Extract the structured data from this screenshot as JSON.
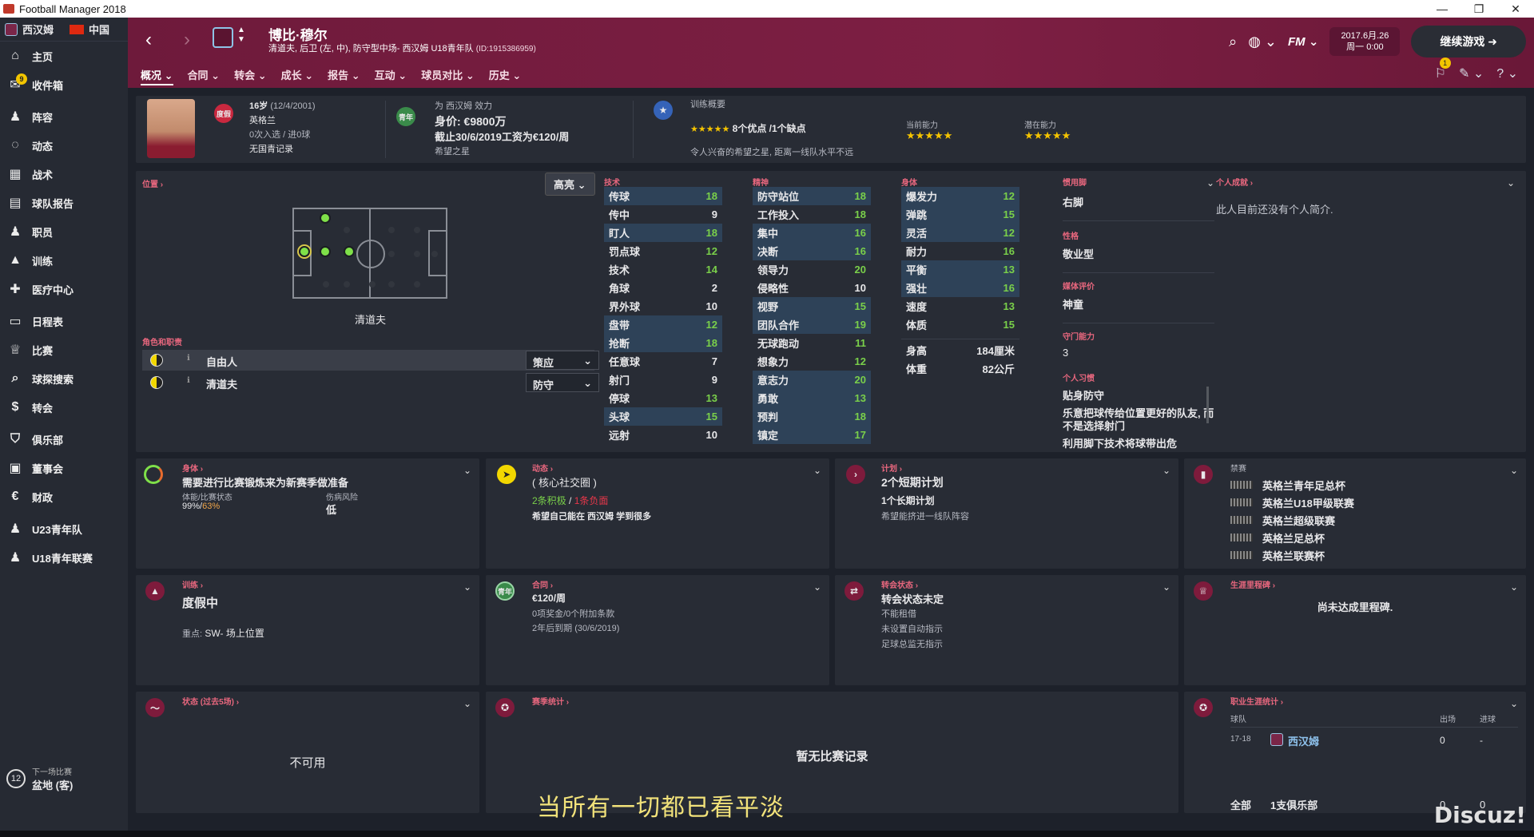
{
  "window": {
    "title": "Football Manager 2018",
    "controls": [
      "—",
      "❐",
      "✕"
    ]
  },
  "sidebar": {
    "club": "西汉姆",
    "nation": "中国",
    "items": [
      {
        "label": "主页",
        "icon": "home-icon",
        "glyph": "⌂"
      },
      {
        "label": "收件箱",
        "icon": "inbox-icon",
        "glyph": "✉",
        "badge": "9"
      },
      {
        "label": "阵容",
        "icon": "squad-icon",
        "glyph": "♟"
      },
      {
        "label": "动态",
        "icon": "dynamics-icon",
        "glyph": "◌"
      },
      {
        "label": "战术",
        "icon": "tactics-icon",
        "glyph": "▦"
      },
      {
        "label": "球队报告",
        "icon": "report-icon",
        "glyph": "▤"
      },
      {
        "label": "职员",
        "icon": "staff-icon",
        "glyph": "♟"
      },
      {
        "label": "训练",
        "icon": "training-icon",
        "glyph": "▲"
      },
      {
        "label": "医疗中心",
        "icon": "medical-icon",
        "glyph": "✚"
      },
      {
        "label": "日程表",
        "icon": "calendar-icon",
        "glyph": "▭"
      },
      {
        "label": "比赛",
        "icon": "trophy-icon",
        "glyph": "♕"
      },
      {
        "label": "球探搜索",
        "icon": "scout-search-icon",
        "glyph": "⌕"
      },
      {
        "label": "转会",
        "icon": "transfer-icon",
        "glyph": "$"
      },
      {
        "label": "俱乐部",
        "icon": "club-icon",
        "glyph": "⛉"
      },
      {
        "label": "董事会",
        "icon": "board-icon",
        "glyph": "▣"
      },
      {
        "label": "财政",
        "icon": "finance-icon",
        "glyph": "€"
      },
      {
        "label": "U23青年队",
        "icon": "u23-icon",
        "glyph": "♟"
      },
      {
        "label": "U18青年联赛",
        "icon": "u18-icon",
        "glyph": "♟"
      }
    ],
    "next_match": {
      "caption": "下一场比赛",
      "opponent": "盆地 (客)",
      "day": "12"
    }
  },
  "header": {
    "player_name": "博比·穆尔",
    "player_sub": "清道夫, 后卫 (左, 中), 防守型中场- 西汉姆 U18青年队",
    "player_id": "(ID:1915386959)",
    "tabs": [
      "概况",
      "合同",
      "转会",
      "成长",
      "报告",
      "互动",
      "球员对比",
      "历史"
    ],
    "date": "2017.6月.26",
    "time": "周一 0:00",
    "continue": "继续游戏",
    "fm_label": "FM",
    "notif_count": "1"
  },
  "summary": {
    "status_badge": "度假",
    "age": "16岁",
    "dob": "(12/4/2001)",
    "nation": "英格兰",
    "caps": "0次入选 / 进0球",
    "youth_record": "无国青记录",
    "youth_badge": "青年",
    "plays_for": "为 西汉姆 效力",
    "value": "身价: €9800万",
    "contract": "截止30/6/2019工资为€120/周",
    "tag": "希望之星",
    "training_title": "训练概要",
    "strengths": "8个优点 /1个缺点",
    "strength_stars": "★★★★★",
    "assessment": "令人兴奋的希望之星, 距离一线队水平不远",
    "current_ability_label": "当前能力",
    "current_ability_stars": "★★★★★",
    "potential_ability_label": "潜在能力",
    "potential_ability_stars": "★★★★★"
  },
  "position": {
    "label": "位置",
    "highlight_btn": "高亮",
    "position_name": "清道夫",
    "roles_label": "角色和职责",
    "roles": [
      {
        "name": "自由人",
        "duty": "策应"
      },
      {
        "name": "清道夫",
        "duty": "防守"
      }
    ]
  },
  "attributes": {
    "technical": {
      "header": "技术",
      "rows": [
        {
          "name": "传球",
          "value": "18",
          "hl": true
        },
        {
          "name": "传中",
          "value": "9",
          "hl": false
        },
        {
          "name": "盯人",
          "value": "18",
          "hl": true
        },
        {
          "name": "罚点球",
          "value": "12",
          "hl": false
        },
        {
          "name": "技术",
          "value": "14",
          "hl": false
        },
        {
          "name": "角球",
          "value": "2",
          "hl": false
        },
        {
          "name": "界外球",
          "value": "10",
          "hl": false
        },
        {
          "name": "盘带",
          "value": "12",
          "hl": true
        },
        {
          "name": "抢断",
          "value": "18",
          "hl": true
        },
        {
          "name": "任意球",
          "value": "7",
          "hl": false
        },
        {
          "name": "射门",
          "value": "9",
          "hl": false
        },
        {
          "name": "停球",
          "value": "13",
          "hl": false
        },
        {
          "name": "头球",
          "value": "15",
          "hl": true
        },
        {
          "name": "远射",
          "value": "10",
          "hl": false
        }
      ]
    },
    "mental": {
      "header": "精神",
      "rows": [
        {
          "name": "防守站位",
          "value": "18",
          "hl": true
        },
        {
          "name": "工作投入",
          "value": "18",
          "hl": false
        },
        {
          "name": "集中",
          "value": "16",
          "hl": true
        },
        {
          "name": "决断",
          "value": "16",
          "hl": true
        },
        {
          "name": "领导力",
          "value": "20",
          "hl": false
        },
        {
          "name": "侵略性",
          "value": "10",
          "hl": false
        },
        {
          "name": "视野",
          "value": "15",
          "hl": true
        },
        {
          "name": "团队合作",
          "value": "19",
          "hl": true
        },
        {
          "name": "无球跑动",
          "value": "11",
          "hl": false
        },
        {
          "name": "想象力",
          "value": "12",
          "hl": false
        },
        {
          "name": "意志力",
          "value": "20",
          "hl": true
        },
        {
          "name": "勇敢",
          "value": "13",
          "hl": true
        },
        {
          "name": "预判",
          "value": "18",
          "hl": true
        },
        {
          "name": "镇定",
          "value": "17",
          "hl": true
        }
      ]
    },
    "physical": {
      "header": "身体",
      "rows": [
        {
          "name": "爆发力",
          "value": "12",
          "hl": true
        },
        {
          "name": "弹跳",
          "value": "15",
          "hl": true
        },
        {
          "name": "灵活",
          "value": "12",
          "hl": true
        },
        {
          "name": "耐力",
          "value": "16",
          "hl": false
        },
        {
          "name": "平衡",
          "value": "13",
          "hl": true
        },
        {
          "name": "强壮",
          "value": "16",
          "hl": true
        },
        {
          "name": "速度",
          "value": "13",
          "hl": false
        },
        {
          "name": "体质",
          "value": "15",
          "hl": false
        }
      ],
      "height_label": "身高",
      "height": "184厘米",
      "weight_label": "体重",
      "weight": "82公斤"
    }
  },
  "info": {
    "foot_label": "惯用脚",
    "foot": "右脚",
    "personality_label": "性格",
    "personality": "敬业型",
    "media_label": "媒体评价",
    "media": "神童",
    "gk_label": "守门能力",
    "gk": "3",
    "habits_label": "个人习惯",
    "habits": [
      "贴身防守",
      "乐意把球传给位置更好的队友, 而不是选择射门",
      "利用脚下技术将球带出危"
    ]
  },
  "achievements": {
    "label": "个人成就",
    "text": "此人目前还没有个人简介."
  },
  "cards": {
    "physical": {
      "label": "身体",
      "title": "需要进行比赛锻炼来为新赛季做准备",
      "fitness_label": "体能/比赛状态",
      "fitness": "99%",
      "match_fitness": "63%",
      "injury_label": "伤病风险",
      "injury": "低"
    },
    "dynamics": {
      "label": "动态",
      "role": "( 核心社交圈 )",
      "positive": "2条积极",
      "negative": "1条负面",
      "note": "希望自己能在 西汉姆 学到很多"
    },
    "plans": {
      "label": "计划",
      "short": "2个短期计划",
      "long": "1个长期计划",
      "note": "希望能挤进一线队阵容"
    },
    "bans": {
      "label": "禁赛",
      "items": [
        "英格兰青年足总杯",
        "英格兰U18甲级联赛",
        "英格兰超级联赛",
        "英格兰足总杯",
        "英格兰联赛杯"
      ]
    },
    "training": {
      "label": "训练",
      "title": "度假中",
      "focus_label": "重点:",
      "focus": "SW- 场上位置"
    },
    "contract": {
      "label": "合同",
      "badge": "青年",
      "wage": "€120/周",
      "bonus": "0项奖金/0个附加条款",
      "expiry": "2年后到期",
      "expiry_date": "(30/6/2019)"
    },
    "transfer": {
      "label": "转会状态",
      "title": "转会状态未定",
      "lines": [
        "不能租借",
        "未设置自动指示",
        "足球总监无指示"
      ]
    },
    "milestones": {
      "label": "生涯里程碑",
      "text": "尚未达成里程碑."
    },
    "form": {
      "label": "状态 (过去5场)",
      "text": "不可用"
    },
    "season": {
      "label": "赛季统计",
      "text": "暂无比赛记录"
    },
    "career": {
      "label": "职业生涯统计",
      "col_club": "球队",
      "col_apps": "出场",
      "col_goals": "进球",
      "rows": [
        {
          "season": "17-18",
          "club": "西汉姆",
          "apps": "0",
          "goals": "-"
        }
      ],
      "total_label": "全部",
      "total_clubs": "1支俱乐部",
      "total_apps": "0",
      "total_goals": "0"
    }
  },
  "overlay": {
    "subtitle": "当所有一切都已看平淡",
    "watermark": "Discuz!"
  },
  "colors": {
    "header": "#7d1f43",
    "accent_red": "#e8677e",
    "highlight_row": "#2e4258",
    "good_value": "#7ad04a"
  }
}
